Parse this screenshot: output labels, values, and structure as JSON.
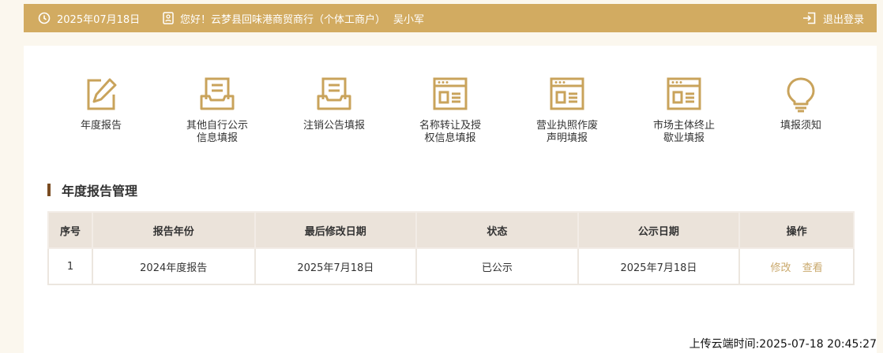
{
  "header": {
    "date": "2025年07月18日",
    "greeting": "您好！云梦县回味港商贸商行（个体工商户）",
    "user": "吴小军",
    "logout_label": "退出登录",
    "bar_color": "#d2ab61"
  },
  "nav": {
    "items": [
      {
        "label": "年度报告",
        "icon": "edit-report-icon"
      },
      {
        "label": "其他自行公示\n信息填报",
        "icon": "document-tray-icon"
      },
      {
        "label": "注销公告填报",
        "icon": "document-tray-icon"
      },
      {
        "label": "名称转让及授\n权信息填报",
        "icon": "browser-form-icon"
      },
      {
        "label": "营业执照作废\n声明填报",
        "icon": "browser-form-icon"
      },
      {
        "label": "市场主体终止\n歇业填报",
        "icon": "browser-form-icon"
      },
      {
        "label": "填报须知",
        "icon": "lightbulb-icon"
      }
    ],
    "icon_color": "#c9a35b"
  },
  "section": {
    "title": "年度报告管理",
    "accent_color": "#7a4c22"
  },
  "table": {
    "headers": [
      "序号",
      "报告年份",
      "最后修改日期",
      "状态",
      "公示日期",
      "操作"
    ],
    "rows": [
      {
        "index": "1",
        "year": "2024年度报告",
        "modified": "2025年7月18日",
        "status": "已公示",
        "published": "2025年7月18日",
        "actions": [
          "修改",
          "查看"
        ]
      }
    ]
  },
  "footer": {
    "upload_time": "上传云端时间:2025-07-18 20:45:27"
  }
}
